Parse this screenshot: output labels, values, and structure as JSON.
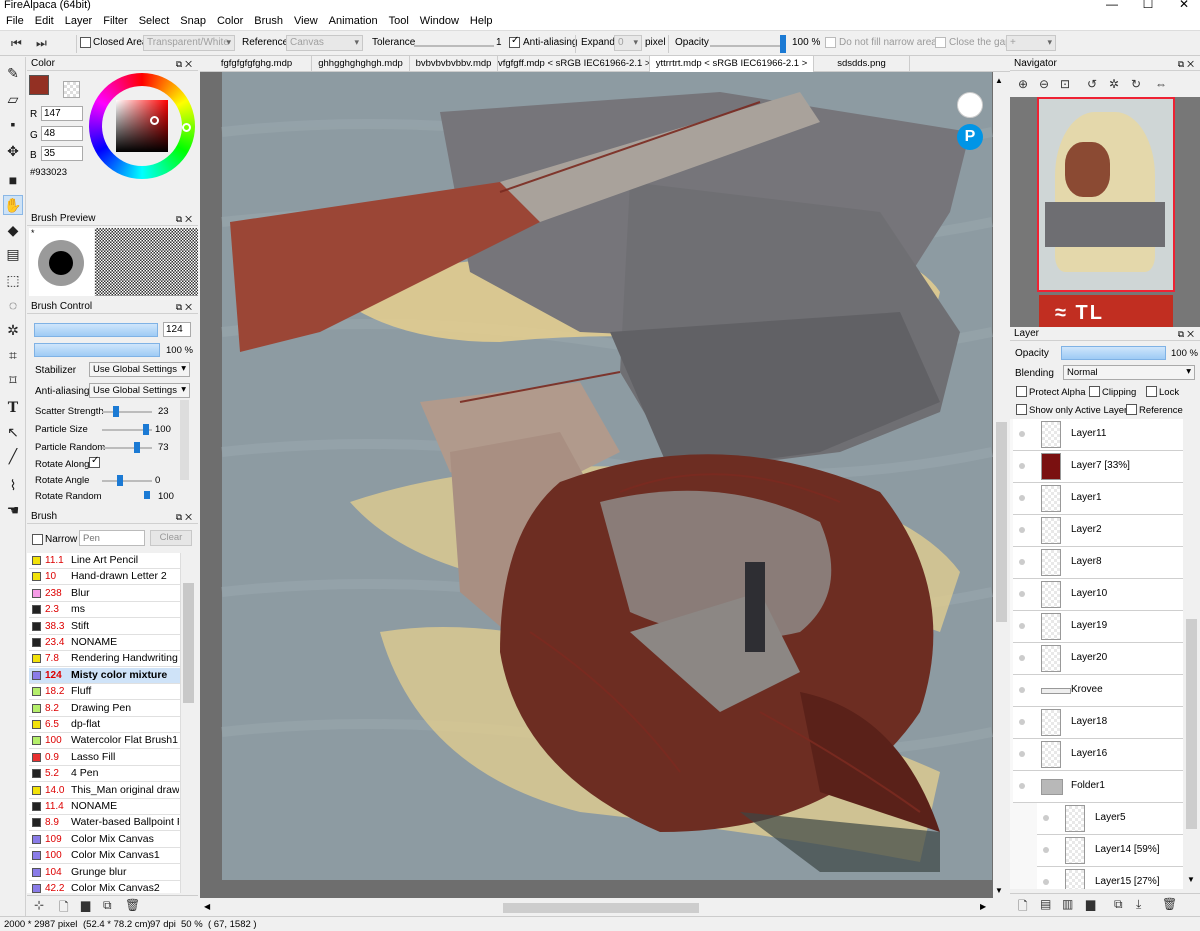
{
  "app": {
    "title": "FireAlpaca (64bit)"
  },
  "menu": [
    "File",
    "Edit",
    "Layer",
    "Filter",
    "Select",
    "Snap",
    "Color",
    "Brush",
    "View",
    "Animation",
    "Tool",
    "Window",
    "Help"
  ],
  "toolbar": {
    "closed_area_label": "Closed Area",
    "closed_area_value": "Transparent/White",
    "reference_label": "Reference",
    "reference_value": "Canvas",
    "tolerance_label": "Tolerance",
    "tolerance_value": "1",
    "antialias_label": "Anti-aliasing",
    "expand_label": "Expand",
    "expand_value": "0",
    "pixel_label": "pixel",
    "opacity_label": "Opacity",
    "opacity_value": "100 %",
    "narrow_label": "Do not fill narrow areas",
    "close_gap_label": "Close the gap",
    "close_gap_value": "+"
  },
  "color": {
    "title": "Color",
    "r": "147",
    "g": "48",
    "b": "35",
    "hex": "#933023",
    "main_swatch": "#933023"
  },
  "brush_preview": {
    "title": "Brush Preview",
    "star": "*"
  },
  "brush_control": {
    "title": "Brush Control",
    "size": "124",
    "opacity": "100 %",
    "size_fraction": 0.97,
    "opacity_fraction": 1.0,
    "stabilizer_label": "Stabilizer",
    "stabilizer_value": "Use Global Settings",
    "antialias_label": "Anti-aliasing",
    "antialias_value": "Use Global Settings",
    "params": [
      {
        "label": "Scatter Strength",
        "value": "23"
      },
      {
        "label": "Particle Size",
        "value": "100"
      },
      {
        "label": "Particle Random",
        "value": "73"
      },
      {
        "label": "Rotate Along",
        "value": ""
      },
      {
        "label": "Rotate Angle",
        "value": "0"
      },
      {
        "label": "Rotate Random",
        "value": "100"
      }
    ]
  },
  "brush_panel": {
    "title": "Brush",
    "narrow_label": "Narrow",
    "search_placeholder": "Pen",
    "clear_label": "Clear",
    "items": [
      {
        "size": "11.1",
        "name": "Line Art Pencil",
        "color": "#f2e20a"
      },
      {
        "size": "10",
        "name": "Hand-drawn Letter 2",
        "color": "#f2e20a"
      },
      {
        "size": "238",
        "name": "Blur",
        "color": "#f59be6"
      },
      {
        "size": "2.3",
        "name": "ms",
        "color": "#222222"
      },
      {
        "size": "38.3",
        "name": "Stift",
        "color": "#222222"
      },
      {
        "size": "23.4",
        "name": "NONAME",
        "color": "#222222"
      },
      {
        "size": "7.8",
        "name": "Rendering Handwriting F",
        "color": "#f2e20a"
      },
      {
        "size": "124",
        "name": "Misty color mixture",
        "color": "#8a7ce8"
      },
      {
        "size": "18.2",
        "name": "Fluff",
        "color": "#b5ef6b"
      },
      {
        "size": "8.2",
        "name": "Drawing Pen",
        "color": "#b5ef6b"
      },
      {
        "size": "6.5",
        "name": "dp-flat",
        "color": "#f2e20a"
      },
      {
        "size": "100",
        "name": "Watercolor Flat Brush1",
        "color": "#b5ef6b"
      },
      {
        "size": "0.9",
        "name": "Lasso Fill",
        "color": "#e83030"
      },
      {
        "size": "5.2",
        "name": "4 Pen",
        "color": "#222222"
      },
      {
        "size": "14.0",
        "name": "This_Man original drawin",
        "color": "#f2e20a"
      },
      {
        "size": "11.4",
        "name": "NONAME",
        "color": "#222222"
      },
      {
        "size": "8.9",
        "name": "Water-based Ballpoint P",
        "color": "#222222"
      },
      {
        "size": "109",
        "name": "Color Mix Canvas",
        "color": "#8a7ce8"
      },
      {
        "size": "100",
        "name": "Color Mix Canvas1",
        "color": "#8a7ce8"
      },
      {
        "size": "104",
        "name": "Grunge blur",
        "color": "#8a7ce8"
      },
      {
        "size": "42.2",
        "name": "Color Mix Canvas2",
        "color": "#8a7ce8"
      }
    ]
  },
  "tabs": [
    {
      "label": "fgfgfgfgfghg.mdp"
    },
    {
      "label": "ghhgghghghgh.mdp"
    },
    {
      "label": "bvbvbvbvbbv.mdp"
    },
    {
      "label": "vfgfgff.mdp < sRGB IEC61966-2.1 >"
    },
    {
      "label": "yttrrtrt.mdp < sRGB IEC61966-2.1 >"
    },
    {
      "label": "sdsdds.png"
    }
  ],
  "navigator": {
    "title": "Navigator"
  },
  "layer_panel": {
    "title": "Layer",
    "opacity_label": "Opacity",
    "opacity_value": "100 %",
    "blending_label": "Blending",
    "blending_value": "Normal",
    "protect_alpha_label": "Protect Alpha",
    "clipping_label": "Clipping",
    "lock_label": "Lock",
    "show_active_label": "Show only Active Layer",
    "reference_label": "Reference",
    "layers": [
      {
        "name": "Layer11",
        "kind": "layer"
      },
      {
        "name": "Layer7 [33%]",
        "kind": "layer"
      },
      {
        "name": "Layer1",
        "kind": "layer"
      },
      {
        "name": "Layer2",
        "kind": "layer"
      },
      {
        "name": "Layer8",
        "kind": "layer"
      },
      {
        "name": "Layer10",
        "kind": "layer"
      },
      {
        "name": "Layer19",
        "kind": "layer"
      },
      {
        "name": "Layer20",
        "kind": "layer"
      },
      {
        "name": "Krovee",
        "kind": "text"
      },
      {
        "name": "Layer18",
        "kind": "layer"
      },
      {
        "name": "Layer16",
        "kind": "layer"
      },
      {
        "name": "Folder1",
        "kind": "folder"
      },
      {
        "name": "Layer5",
        "kind": "layer"
      },
      {
        "name": "Layer14 [59%]",
        "kind": "layer"
      },
      {
        "name": "Layer15 [27%]",
        "kind": "layer"
      }
    ]
  },
  "status": {
    "size": "2000 * 2987 pixel",
    "cm": "(52.4 * 78.2 cm)",
    "dpi": "97 dpi",
    "zoom": "50 %",
    "coords": "( 67, 1582 )"
  }
}
